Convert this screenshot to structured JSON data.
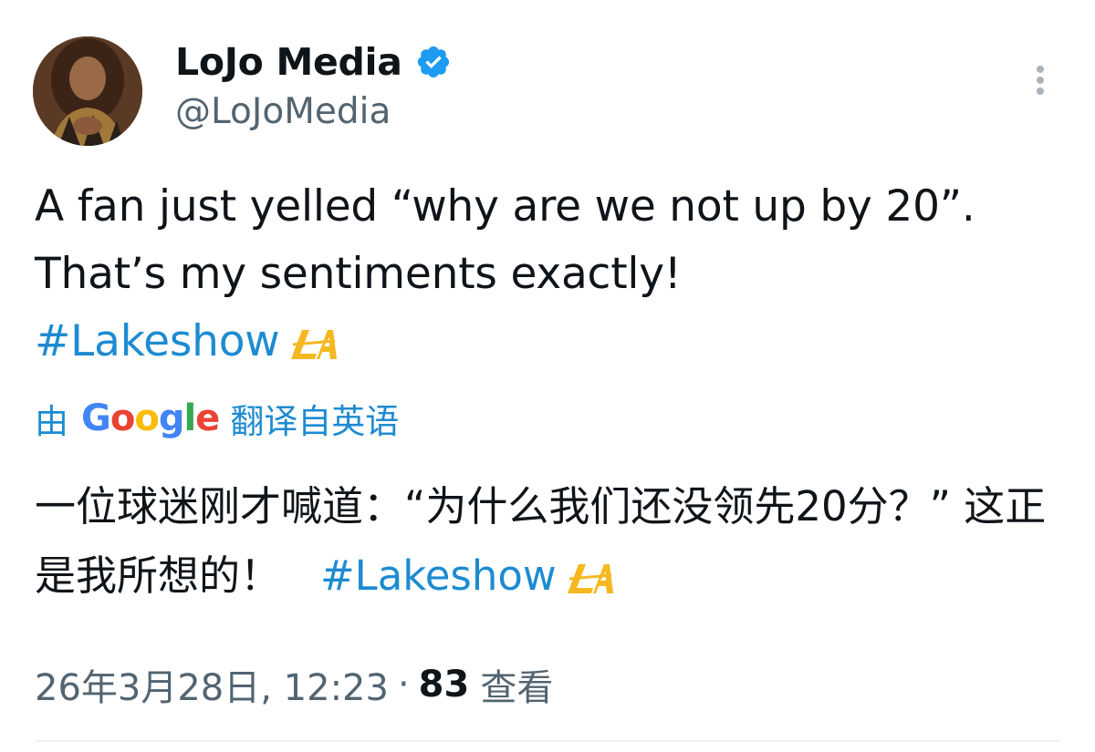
{
  "author": {
    "display_name": "LoJo Media",
    "handle": "@LoJoMedia",
    "verified": true
  },
  "tweet": {
    "text": "A fan just yelled “why are we not up by 20”. That’s my sentiments exactly!",
    "hashtag": "#Lakeshow",
    "emoji_icon": "la-lakers-logo-icon"
  },
  "translation": {
    "prefix": "由",
    "brand": "Google",
    "suffix": "翻译自英语",
    "text": "一位球迷刚才喊道：“为什么我们还没领先20分？” 这正是我所想的！",
    "hashtag": "#Lakeshow"
  },
  "meta": {
    "timestamp": "26年3月28日, 12:23",
    "separator": "·",
    "views_count": "83",
    "views_label": "查看"
  },
  "colors": {
    "link": "#1d8bd1",
    "text": "#0f1419",
    "secondary": "#536471",
    "verified": "#1d9bf0",
    "lakers_gold": "#f5b820"
  }
}
